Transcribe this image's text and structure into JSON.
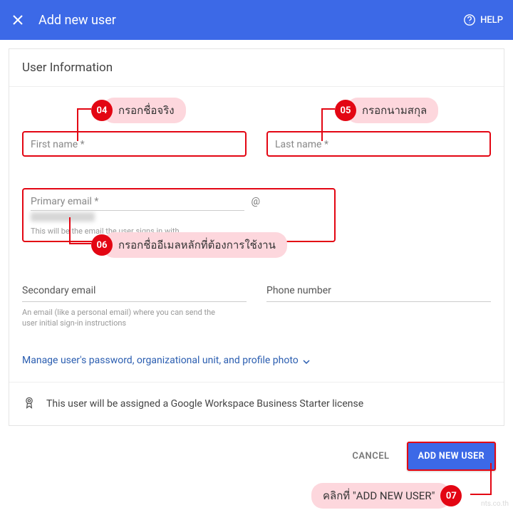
{
  "header": {
    "title": "Add new user",
    "help": "HELP"
  },
  "panel": {
    "heading": "User Information",
    "first_name_label": "First name *",
    "last_name_label": "Last name *",
    "primary_email_label": "Primary email *",
    "primary_email_at": "@",
    "primary_email_help": "This will be the email the user signs in with",
    "secondary_email_label": "Secondary email",
    "secondary_email_help": "An email (like a personal email) where you can send the user initial sign-in instructions",
    "phone_label": "Phone number",
    "manage_link": "Manage user's password, organizational unit, and profile photo",
    "license_text": "This user will be assigned a Google Workspace Business Starter license"
  },
  "footer": {
    "cancel": "CANCEL",
    "submit": "ADD NEW USER"
  },
  "annotations": {
    "c04_num": "04",
    "c04_text": "กรอกชื่อจริง",
    "c05_num": "05",
    "c05_text": "กรอกนามสกุล",
    "c06_num": "06",
    "c06_text": "กรอกชื่ออีเมลหลักที่ต้องการใช้งาน",
    "c07_num": "07",
    "c07_text": "คลิกที่ \"ADD NEW USER\""
  },
  "watermark": "nts.co.th"
}
